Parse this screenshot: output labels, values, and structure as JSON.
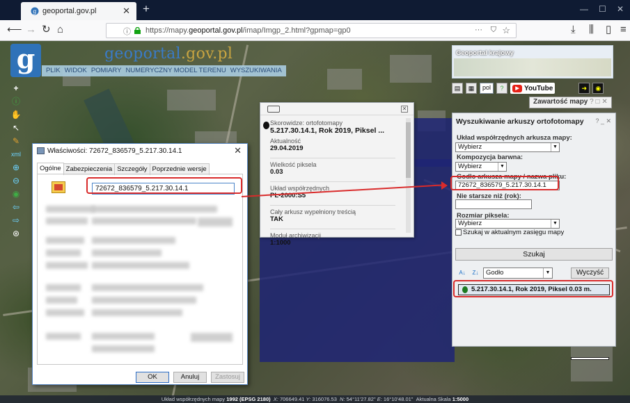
{
  "browser": {
    "tab_title": "geoportal.gov.pl",
    "url_prefix": "https://mapy.",
    "url_domain": "geoportal.gov.pl",
    "url_suffix": "/imap/Imgp_2.html?gpmap=gp0"
  },
  "geoportal": {
    "logo_letter": "g",
    "title_main": "geoportal",
    "title_rest": ".gov.pl",
    "menu": [
      "PLIK",
      "WIDOK",
      "POMIARY",
      "NUMERYCZNY MODEL TERENU",
      "WYSZUKIWANIA"
    ],
    "overview_title": "Geoportal krajowy",
    "lang": "pol",
    "youtube": "YouTube",
    "contents_label": "Zawartość mapy",
    "panel_controls": "? □ ✕"
  },
  "popup": {
    "label_index": "Skorowidze: ortofotomapy",
    "sheet_title": "5.217.30.14.1, Rok 2019, Piksel ...",
    "fields": [
      {
        "label": "Aktualność",
        "value": "29.04.2019"
      },
      {
        "label": "Wielkość piksela",
        "value": "0.03"
      },
      {
        "label": "Układ współrzędnych",
        "value": "PL-2000:S5"
      },
      {
        "label": "Cały arkusz wypełniony treścią",
        "value": "TAK"
      },
      {
        "label": "Moduł archiwizacji",
        "value": "1:1000"
      }
    ]
  },
  "search": {
    "title": "Wyszukiwanie arkuszy ortofotomapy",
    "controls": "? _ ✕",
    "coord_label": "Układ współrzędnych arkusza mapy:",
    "coord_value": "Wybierz",
    "color_label": "Kompozycja barwna:",
    "color_value": "Wybierz",
    "sheet_label": "Godło arkusza mapy / nazwa pliku:",
    "sheet_value": "72672_836579_5.217.30.14.1",
    "year_label": "Nie starsze niż (rok):",
    "year_value": "",
    "pixel_label": "Rozmiar piksela:",
    "pixel_value": "Wybierz",
    "extent_label": "Szukaj w aktualnym zasięgu mapy",
    "search_button": "Szukaj",
    "sort_value": "Godło",
    "clear_button": "Wyczyść",
    "result": "5.217.30.14.1, Rok 2019, Piksel 0.03 m."
  },
  "dialog": {
    "title": "Właściwości: 72672_836579_5.217.30.14.1",
    "tabs": [
      "Ogólne",
      "Zabezpieczenia",
      "Szczegóły",
      "Poprzednie wersje"
    ],
    "filename": "72672_836579_5.217.30.14.1",
    "ok": "OK",
    "cancel": "Anuluj",
    "apply": "Zastosuj"
  },
  "statusbar": {
    "crs_label": "Układ współrzędnych mapy",
    "crs_value": "1992 (EPSG 2180)",
    "x_label": "X:",
    "x_value": "706649.41",
    "y_label": "Y:",
    "y_value": "316076.53",
    "n_label": "N:",
    "n_value": "54°11'27.82\"",
    "e_label": "E:",
    "e_value": "16°10'48.01\"",
    "scale_label": "Aktualna Skala",
    "scale_value": "1:5000"
  },
  "colors": {
    "highlight": "#d92b2b",
    "overlay": "#1f2474",
    "accent": "#2f72b8"
  }
}
